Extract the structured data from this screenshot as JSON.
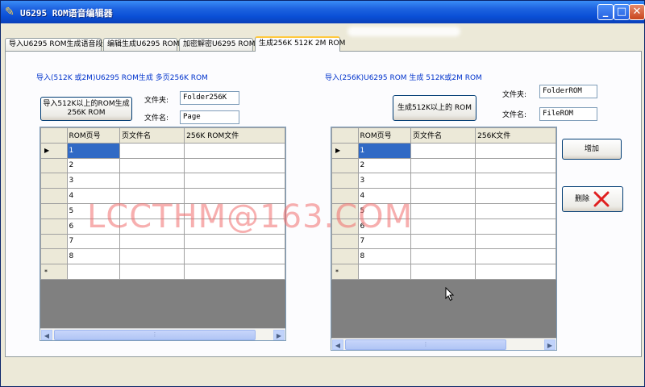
{
  "window": {
    "title": "U6295 ROM语音编辑器"
  },
  "tabs": [
    {
      "label": "导入U6295 ROM生成语音段"
    },
    {
      "label": "编辑生成U6295 ROM"
    },
    {
      "label": "加密解密U6295 ROM"
    },
    {
      "label": "生成256K 512K 2M ROM"
    }
  ],
  "left": {
    "heading": "导入(512K 或2M)U6295 ROM生成 多页256K ROM",
    "button_line1": "导入512K以上的ROM生成",
    "button_line2": "256K ROM",
    "folder_label": "文件夹:",
    "folder_value": "Folder256K",
    "file_label": "文件名:",
    "file_value": "Page",
    "columns": [
      "ROM页号",
      "页文件名",
      "256K ROM文件"
    ],
    "rows": [
      "1",
      "2",
      "3",
      "4",
      "5",
      "6",
      "7",
      "8"
    ]
  },
  "right": {
    "heading": "导入(256K)U6295 ROM 生成 512K或2M ROM",
    "button_label": "生成512K以上的 ROM",
    "folder_label": "文件夹:",
    "folder_value": "FolderROM",
    "file_label": "文件名:",
    "file_value": "FileROM",
    "columns": [
      "ROM页号",
      "页文件名",
      "256K文件"
    ],
    "rows": [
      "1",
      "2",
      "3",
      "4",
      "5",
      "6",
      "7",
      "8"
    ],
    "add_button": "增加",
    "delete_button": "删除"
  },
  "grid_markers": {
    "current": "▶",
    "new": "*"
  },
  "watermark": "LCCTHM@163.COM",
  "icons": {
    "app": "pen-icon",
    "delete": "red-x-icon"
  }
}
